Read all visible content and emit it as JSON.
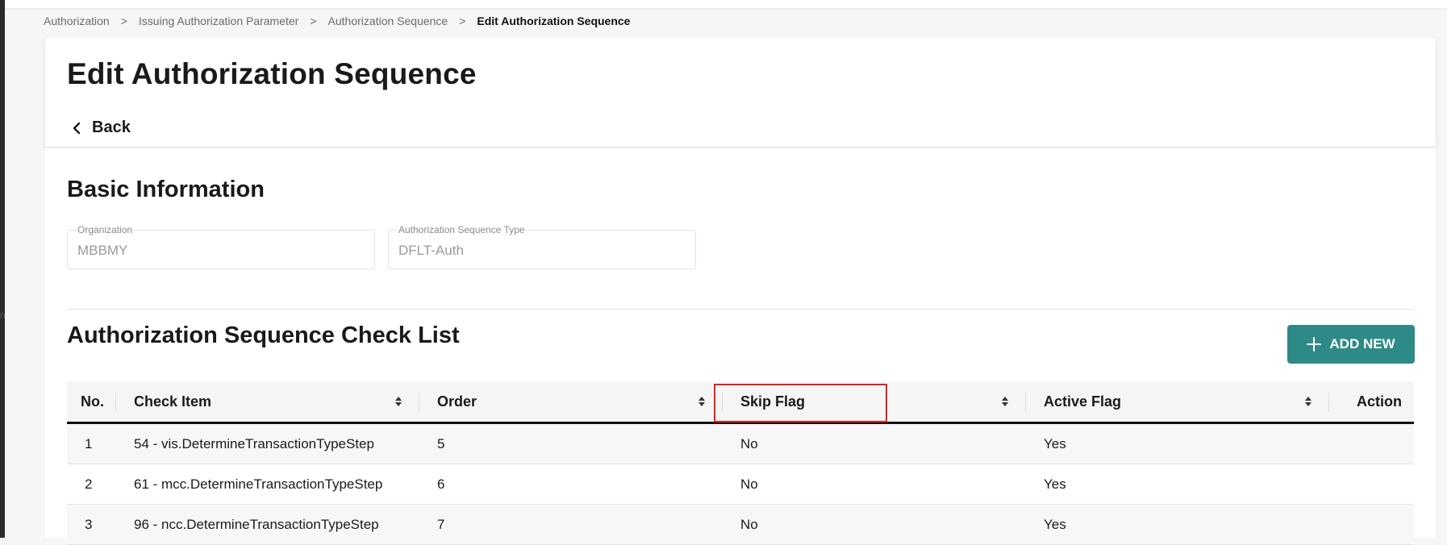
{
  "breadcrumb": {
    "items": [
      "Authorization",
      "Issuing Authorization Parameter",
      "Authorization Sequence"
    ],
    "current": "Edit Authorization Sequence",
    "separator": ">"
  },
  "header": {
    "title": "Edit Authorization Sequence",
    "back_label": "Back"
  },
  "basic_info": {
    "title": "Basic Information",
    "organization": {
      "label": "Organization",
      "value": "MBBMY"
    },
    "sequence_type": {
      "label": "Authorization Sequence Type",
      "value": "DFLT-Auth"
    }
  },
  "checklist": {
    "title": "Authorization Sequence Check List",
    "add_new_label": "ADD NEW",
    "columns": {
      "no": "No.",
      "check_item": "Check Item",
      "order": "Order",
      "skip_flag": "Skip Flag",
      "active_flag": "Active Flag",
      "action": "Action"
    },
    "rows": [
      {
        "no": "1",
        "check_item": "54 - vis.DetermineTransactionTypeStep",
        "order": "5",
        "skip_flag": "No",
        "active_flag": "Yes"
      },
      {
        "no": "2",
        "check_item": "61 - mcc.DetermineTransactionTypeStep",
        "order": "6",
        "skip_flag": "No",
        "active_flag": "Yes"
      },
      {
        "no": "3",
        "check_item": "96 - ncc.DetermineTransactionTypeStep",
        "order": "7",
        "skip_flag": "No",
        "active_flag": "Yes"
      }
    ]
  },
  "colors": {
    "accent": "#2e8a86",
    "highlight": "#e0201c"
  },
  "left_rail_glyph": "n"
}
